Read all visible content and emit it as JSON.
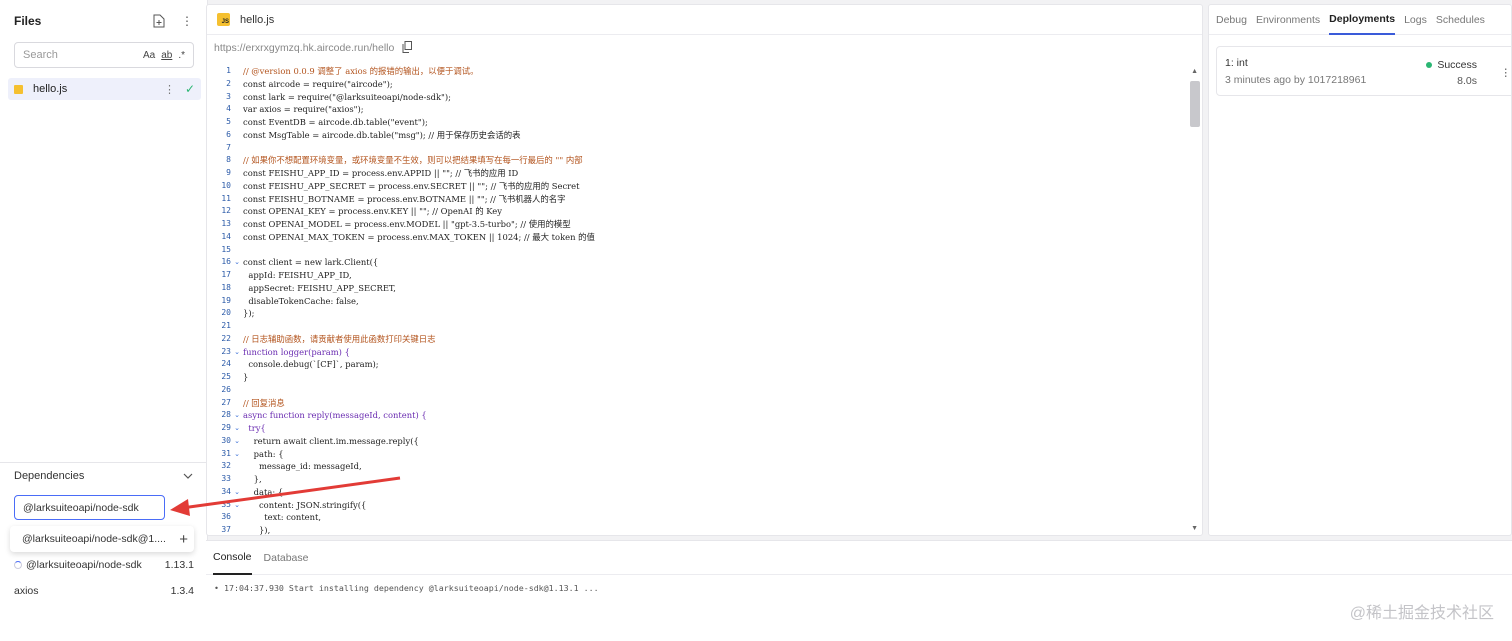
{
  "files": {
    "title": "Files",
    "search_placeholder": "Search",
    "opt_case": "Aa",
    "opt_word": "ab",
    "opt_regex": ".*",
    "items": [
      {
        "name": "hello.js"
      }
    ]
  },
  "deps": {
    "title": "Dependencies",
    "input_value": "@larksuiteoapi/node-sdk",
    "suggestion": "@larksuiteoapi/node-sdk@1....",
    "items": [
      {
        "name": "@larksuiteoapi/node-sdk",
        "version": "1.13.1"
      },
      {
        "name": "axios",
        "version": "1.3.4"
      }
    ]
  },
  "editor": {
    "tab": "hello.js",
    "url": "https://erxrxgymzq.hk.aircode.run/hello",
    "lines": [
      {
        "n": "1",
        "f": "",
        "t": "// @version 0.0.9 调整了 axios 的报错的输出，以便于调试。",
        "c": "tk-c"
      },
      {
        "n": "2",
        "f": "",
        "t": "const aircode = require(\"aircode\");",
        "c": "ct"
      },
      {
        "n": "3",
        "f": "",
        "t": "const lark = require(\"@larksuiteoapi/node-sdk\");",
        "c": "ct"
      },
      {
        "n": "4",
        "f": "",
        "t": "var axios = require(\"axios\");",
        "c": "ct"
      },
      {
        "n": "5",
        "f": "",
        "t": "const EventDB = aircode.db.table(\"event\");",
        "c": "ct"
      },
      {
        "n": "6",
        "f": "",
        "t": "const MsgTable = aircode.db.table(\"msg\"); // 用于保存历史会话的表",
        "c": "ct"
      },
      {
        "n": "7",
        "f": "",
        "t": "",
        "c": "ct"
      },
      {
        "n": "8",
        "f": "",
        "t": "// 如果你不想配置环境变量，或环境变量不生效，则可以把结果填写在每一行最后的 \"\" 内部",
        "c": "tk-c"
      },
      {
        "n": "9",
        "f": "",
        "t": "const FEISHU_APP_ID = process.env.APPID || \"\"; // 飞书的应用 ID",
        "c": "ct"
      },
      {
        "n": "10",
        "f": "",
        "t": "const FEISHU_APP_SECRET = process.env.SECRET || \"\"; // 飞书的应用的 Secret",
        "c": "ct"
      },
      {
        "n": "11",
        "f": "",
        "t": "const FEISHU_BOTNAME = process.env.BOTNAME || \"\"; // 飞书机器人的名字",
        "c": "ct"
      },
      {
        "n": "12",
        "f": "",
        "t": "const OPENAI_KEY = process.env.KEY || \"\"; // OpenAI 的 Key",
        "c": "ct"
      },
      {
        "n": "13",
        "f": "",
        "t": "const OPENAI_MODEL = process.env.MODEL || \"gpt-3.5-turbo\"; // 使用的模型",
        "c": "ct"
      },
      {
        "n": "14",
        "f": "",
        "t": "const OPENAI_MAX_TOKEN = process.env.MAX_TOKEN || 1024; // 最大 token 的值",
        "c": "ct"
      },
      {
        "n": "15",
        "f": "",
        "t": "",
        "c": "ct"
      },
      {
        "n": "16",
        "f": "⌄",
        "t": "const client = new lark.Client({",
        "c": "ct"
      },
      {
        "n": "17",
        "f": "",
        "t": "  appId: FEISHU_APP_ID,",
        "c": "ct"
      },
      {
        "n": "18",
        "f": "",
        "t": "  appSecret: FEISHU_APP_SECRET,",
        "c": "ct"
      },
      {
        "n": "19",
        "f": "",
        "t": "  disableTokenCache: false,",
        "c": "ct"
      },
      {
        "n": "20",
        "f": "",
        "t": "});",
        "c": "ct"
      },
      {
        "n": "21",
        "f": "",
        "t": "",
        "c": "ct"
      },
      {
        "n": "22",
        "f": "",
        "t": "// 日志辅助函数，请贡献者使用此函数打印关键日志",
        "c": "tk-c"
      },
      {
        "n": "23",
        "f": "⌄",
        "t": "function logger(param) {",
        "c": "tk-k"
      },
      {
        "n": "24",
        "f": "",
        "t": "  console.debug(`[CF]`, param);",
        "c": "ct"
      },
      {
        "n": "25",
        "f": "",
        "t": "}",
        "c": "ct"
      },
      {
        "n": "26",
        "f": "",
        "t": "",
        "c": "ct"
      },
      {
        "n": "27",
        "f": "",
        "t": "// 回复消息",
        "c": "tk-c"
      },
      {
        "n": "28",
        "f": "⌄",
        "t": "async function reply(messageId, content) {",
        "c": "tk-k"
      },
      {
        "n": "29",
        "f": "⌄",
        "t": "  try{",
        "c": "tk-k"
      },
      {
        "n": "30",
        "f": "⌄",
        "t": "    return await client.im.message.reply({",
        "c": "ct"
      },
      {
        "n": "31",
        "f": "⌄",
        "t": "    path: {",
        "c": "ct"
      },
      {
        "n": "32",
        "f": "",
        "t": "      message_id: messageId,",
        "c": "ct"
      },
      {
        "n": "33",
        "f": "",
        "t": "    },",
        "c": "ct"
      },
      {
        "n": "34",
        "f": "⌄",
        "t": "    data: {",
        "c": "ct"
      },
      {
        "n": "35",
        "f": "⌄",
        "t": "      content: JSON.stringify({",
        "c": "ct"
      },
      {
        "n": "36",
        "f": "",
        "t": "        text: content,",
        "c": "ct"
      },
      {
        "n": "37",
        "f": "",
        "t": "      }),",
        "c": "ct"
      }
    ]
  },
  "console": {
    "tabs": [
      "Console",
      "Database"
    ],
    "log": "• 17:04:37.930 Start installing dependency @larksuiteoapi/node-sdk@1.13.1 ..."
  },
  "right": {
    "tabs": [
      "Debug",
      "Environments",
      "Deployments",
      "Logs",
      "Schedules"
    ],
    "active_tab": "Deployments",
    "deployment": {
      "name": "1: int",
      "meta": "3 minutes ago by 1017218961",
      "status": "Success",
      "duration": "8.0s",
      "status_color": "#2bb673"
    }
  },
  "watermark": "@稀土掘金技术社区"
}
